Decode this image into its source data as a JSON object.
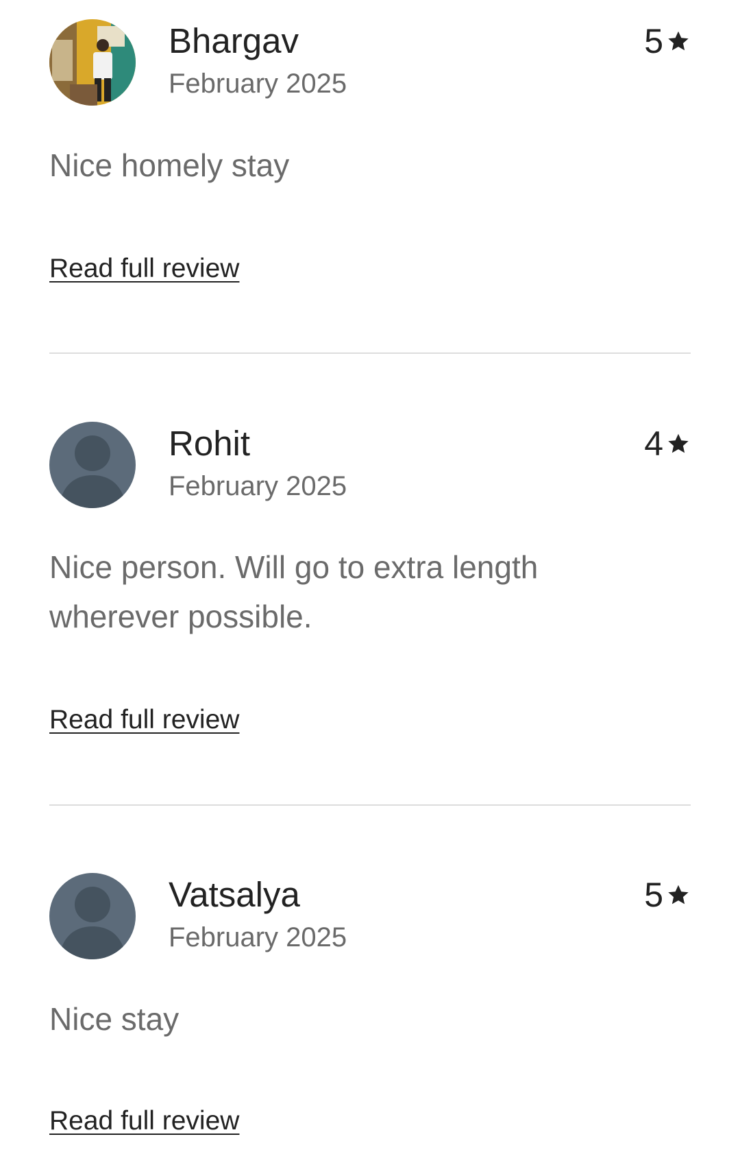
{
  "reviews": [
    {
      "name": "Bhargav",
      "date": "February 2025",
      "rating": "5",
      "text": "Nice homely stay",
      "read_more": "Read full review",
      "avatar": "user-photo"
    },
    {
      "name": "Rohit",
      "date": "February 2025",
      "rating": "4",
      "text": "Nice person. Will go to extra length wherever possible.",
      "read_more": "Read full review",
      "avatar": "default-person-icon"
    },
    {
      "name": "Vatsalya",
      "date": "February 2025",
      "rating": "5",
      "text": "Nice stay",
      "read_more": "Read full review",
      "avatar": "default-person-icon"
    }
  ],
  "colors": {
    "primary_text": "#222222",
    "secondary_text": "#6a6a6a",
    "divider": "#dddddd",
    "default_avatar_bg": "#5c6b7a",
    "default_avatar_figure": "#45535f"
  }
}
